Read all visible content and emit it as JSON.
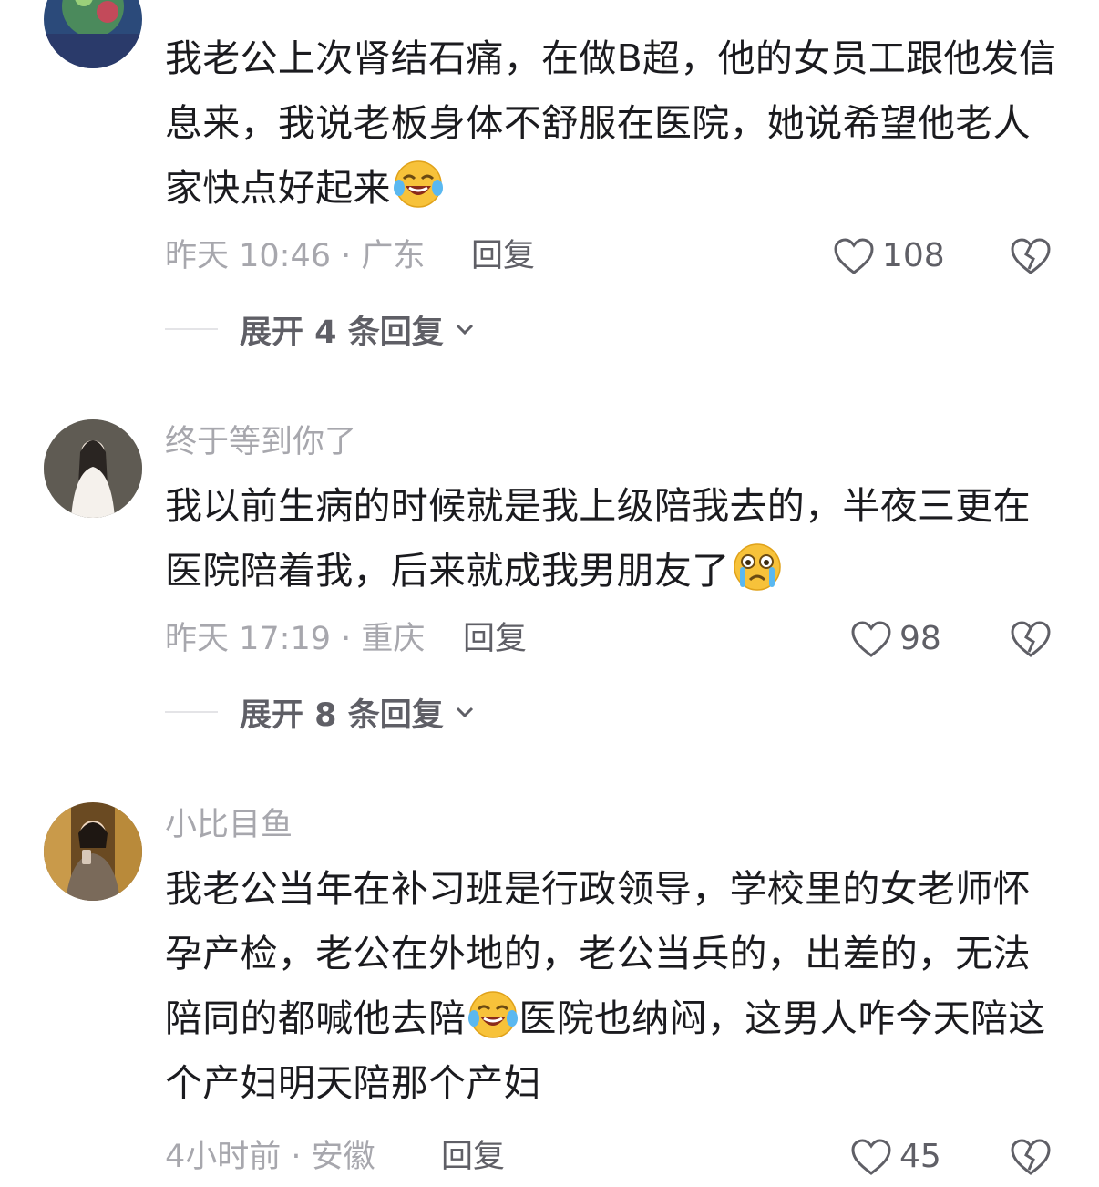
{
  "comments": [
    {
      "username": "",
      "text_parts": [
        "我老公上次肾结石痛，在做B超，他的女员工跟他发信息来，我说老板身体不舒服在医院，她说希望他老人家快点好起来"
      ],
      "emoji": "laughing-crying-emoji",
      "time": "昨天 10:46 · 广东",
      "reply_label": "回复",
      "likes": "108",
      "expand_label": "展开 4 条回复"
    },
    {
      "username": "终于等到你了",
      "text_parts": [
        "我以前生病的时候就是我上级陪我去的，半夜三更在医院陪着我，后来就成我男朋友了"
      ],
      "emoji": "crying-emoji",
      "time": "昨天 17:19 · 重庆",
      "reply_label": "回复",
      "likes": "98",
      "expand_label": "展开 8 条回复"
    },
    {
      "username": "小比目鱼",
      "text_parts": [
        "我老公当年在补习班是行政领导，学校里的女老师怀孕产检，老公在外地的，老公当兵的，出差的，无法陪同的都喊他去陪",
        "医院也纳闷，这男人咋今天陪这个产妇明天陪那个产妇"
      ],
      "emoji": "laughing-crying-emoji",
      "time": "4小时前 · 安徽",
      "reply_label": "回复",
      "likes": "45"
    }
  ],
  "colors": {
    "text": "#1b1b1f",
    "meta": "#a7a7ad",
    "action": "#5f5f66",
    "emoji": "#f7c23a"
  }
}
